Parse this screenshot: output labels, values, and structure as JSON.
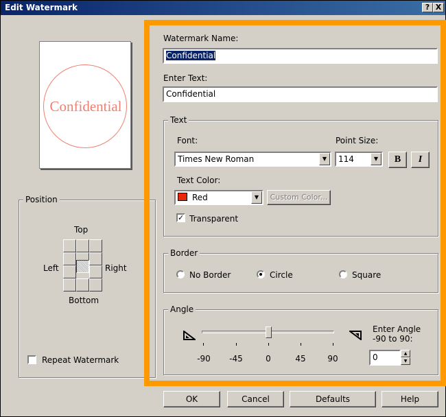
{
  "window": {
    "title": "Edit Watermark",
    "help_button": "?",
    "close_button": "X"
  },
  "preview": {
    "text": "Confidential",
    "color": "#f08070",
    "border": "circle"
  },
  "position": {
    "legend": "Position",
    "top_label": "Top",
    "left_label": "Left",
    "right_label": "Right",
    "bottom_label": "Bottom",
    "selected": "center",
    "repeat_label": "Repeat Watermark",
    "repeat_checked": false
  },
  "form": {
    "name_label": "Watermark Name:",
    "name_value": "Confidential",
    "text_label": "Enter Text:",
    "text_value": "Confidential"
  },
  "text_group": {
    "legend": "Text",
    "font_label": "Font:",
    "font_value": "Times New Roman",
    "point_size_label": "Point Size:",
    "point_size_value": "114",
    "bold_label": "B",
    "italic_label": "I",
    "color_label": "Text Color:",
    "color_value": "Red",
    "color_swatch": "#e8280a",
    "custom_color_label": "Custom Color...",
    "transparent_label": "Transparent",
    "transparent_checked": true
  },
  "border_group": {
    "legend": "Border",
    "options": [
      {
        "label": "No Border",
        "selected": false
      },
      {
        "label": "Circle",
        "selected": true
      },
      {
        "label": "Square",
        "selected": false
      }
    ]
  },
  "angle_group": {
    "legend": "Angle",
    "ticks": [
      "-90",
      "-45",
      "0",
      "45",
      "90"
    ],
    "slider_value": 0,
    "enter_label_line1": "Enter Angle",
    "enter_label_line2": "-90 to 90:",
    "angle_value": "0"
  },
  "buttons": {
    "ok": "OK",
    "cancel": "Cancel",
    "defaults": "Defaults",
    "help": "Help"
  },
  "colors": {
    "highlight": "#ff9900",
    "titlebar": "#0a246a",
    "dialog_bg": "#d4d0c8"
  }
}
